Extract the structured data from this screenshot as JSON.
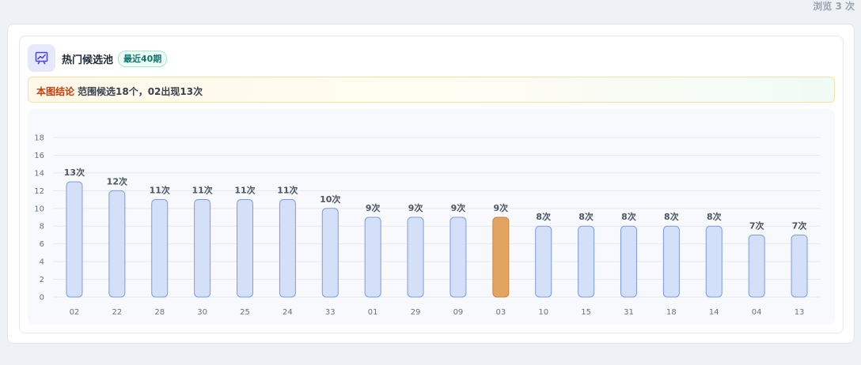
{
  "header": {
    "views": "浏览 3 次"
  },
  "card": {
    "title": "热门候选池",
    "badge": "最近40期",
    "conclusion_label": "本图结论",
    "conclusion_text": "范围候选18个，02出现13次"
  },
  "chart_data": {
    "type": "bar",
    "categories": [
      "02",
      "22",
      "28",
      "30",
      "25",
      "24",
      "33",
      "01",
      "29",
      "09",
      "03",
      "10",
      "15",
      "31",
      "18",
      "14",
      "04",
      "13"
    ],
    "values": [
      13,
      12,
      11,
      11,
      11,
      11,
      10,
      9,
      9,
      9,
      9,
      8,
      8,
      8,
      8,
      8,
      7,
      7
    ],
    "value_labels": [
      "13次",
      "12次",
      "11次",
      "11次",
      "11次",
      "11次",
      "10次",
      "9次",
      "9次",
      "9次",
      "9次",
      "8次",
      "8次",
      "8次",
      "8次",
      "8次",
      "7次",
      "7次"
    ],
    "highlight_category": "03",
    "ylim": [
      0,
      18
    ],
    "yticks": [
      0,
      2,
      4,
      6,
      8,
      10,
      12,
      14,
      16,
      18
    ],
    "grid": true,
    "colors": {
      "bar_fill": "#d3e0f8",
      "bar_stroke": "#7c9be6",
      "highlight_fill": "#e3a462",
      "highlight_stroke": "#c98642",
      "grid": "#e6eaf0",
      "tick_text": "#6b7280",
      "value_text": "#4b5563"
    }
  }
}
